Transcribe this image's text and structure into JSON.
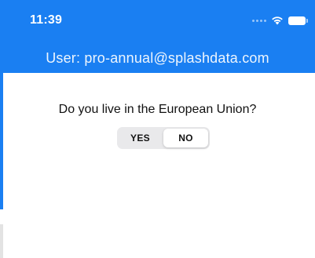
{
  "status_bar": {
    "time": "11:39",
    "wifi_icon": "wifi-icon",
    "battery_icon": "battery-icon"
  },
  "header": {
    "user_label": "User: pro-annual@splashdata.com",
    "background_color": "#1a7ff2"
  },
  "main": {
    "question": "Do you live in the European Union?",
    "options": [
      "YES",
      "NO"
    ],
    "selected": "NO"
  }
}
